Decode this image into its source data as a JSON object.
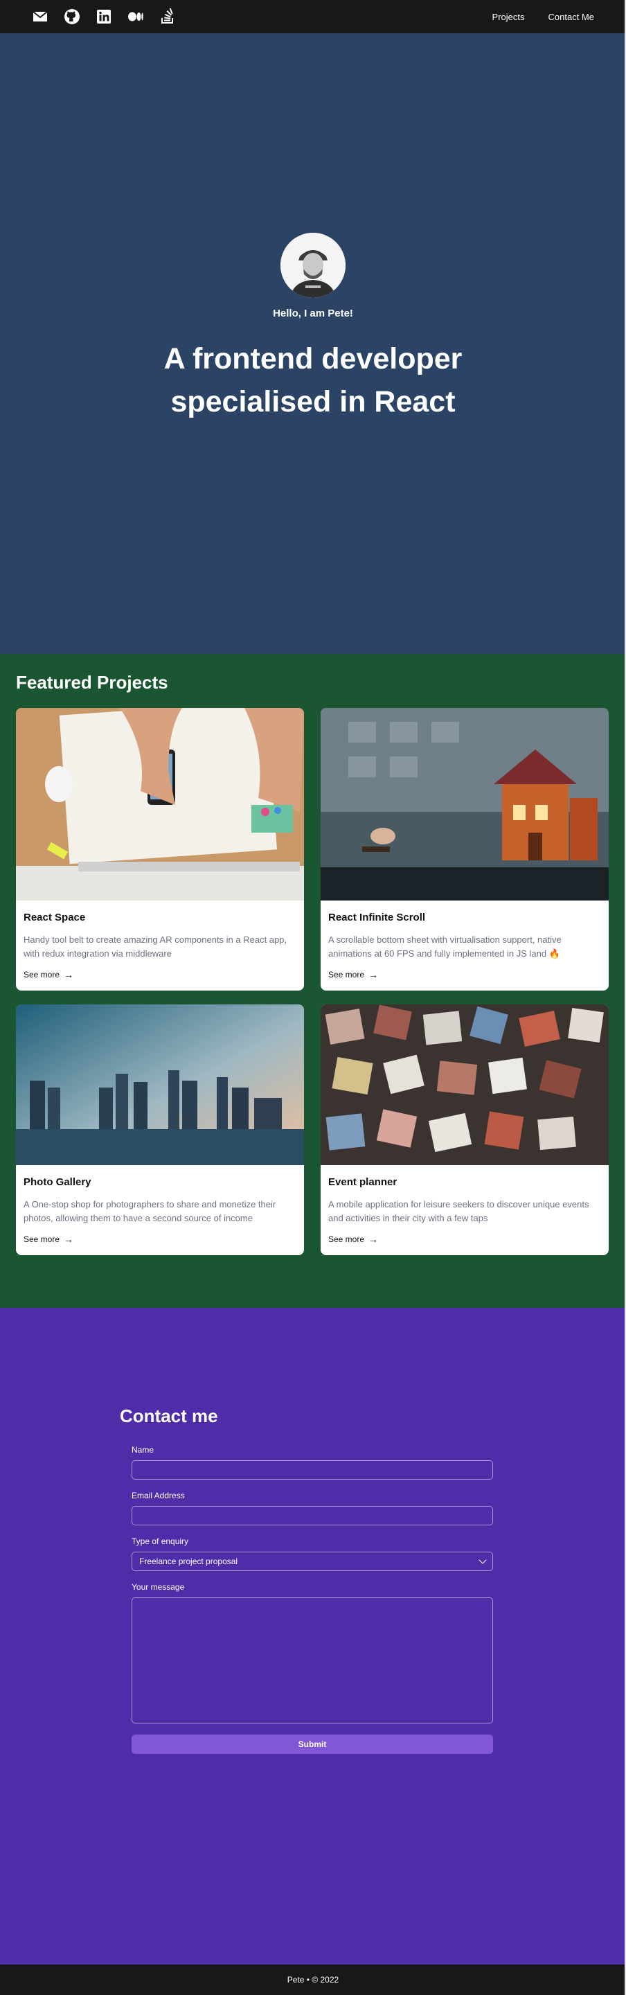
{
  "header": {
    "socials": [
      {
        "icon": "envelope-icon"
      },
      {
        "icon": "github-icon"
      },
      {
        "icon": "linkedin-icon"
      },
      {
        "icon": "medium-icon"
      },
      {
        "icon": "stackoverflow-icon"
      }
    ],
    "nav": {
      "projects": "Projects",
      "contact": "Contact Me"
    }
  },
  "hero": {
    "greeting": "Hello, I am Pete!",
    "headline": "A frontend developer specialised in React",
    "bg_color": "#2b4365"
  },
  "projects": {
    "title": "Featured Projects",
    "bg_color": "#1a5632",
    "see_more": "See more",
    "items": [
      {
        "title": "React Space",
        "description": "Handy tool belt to create amazing AR components in a React app, with redux integration via middleware"
      },
      {
        "title": "React Infinite Scroll",
        "description": "A scrollable bottom sheet with virtualisation support, native animations at 60 FPS and fully implemented in JS land 🔥"
      },
      {
        "title": "Photo Gallery",
        "description": "A One-stop shop for photographers to share and monetize their photos, allowing them to have a second source of income"
      },
      {
        "title": "Event planner",
        "description": "A mobile application for leisure seekers to discover unique events and activities in their city with a few taps"
      }
    ]
  },
  "contact": {
    "title": "Contact me",
    "bg_color": "#4f2ca8",
    "name_label": "Name",
    "name_value": "",
    "email_label": "Email Address",
    "email_value": "",
    "type_label": "Type of enquiry",
    "type_selected": "Freelance project proposal",
    "message_label": "Your message",
    "submit_label": "Submit"
  },
  "footer": {
    "text": "Pete • © 2022"
  }
}
